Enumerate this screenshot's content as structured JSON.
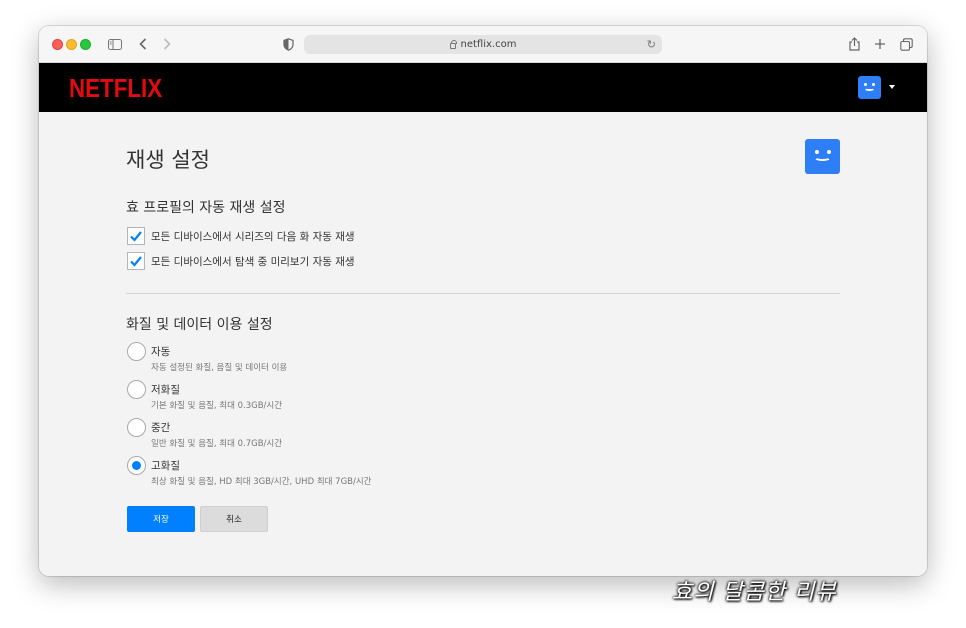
{
  "browser": {
    "url": "netflix.com"
  },
  "header": {
    "logo": "NETFLIX"
  },
  "page": {
    "title": "재생 설정",
    "autoplay_section": {
      "title": "효 프로필의 자동 재생 설정",
      "options": [
        {
          "label": "모든 디바이스에서 시리즈의 다음 화 자동 재생",
          "checked": true
        },
        {
          "label": "모든 디바이스에서 탐색 중 미리보기 자동 재생",
          "checked": true
        }
      ]
    },
    "quality_section": {
      "title": "화질 및 데이터 이용 설정",
      "options": [
        {
          "label": "자동",
          "desc": "자동 설정된 화질, 음질 및 데이터 이용",
          "selected": false
        },
        {
          "label": "저화질",
          "desc": "기본 화질 및 음질, 최대 0.3GB/시간",
          "selected": false
        },
        {
          "label": "중간",
          "desc": "일반 화질 및 음질, 최대 0.7GB/시간",
          "selected": false
        },
        {
          "label": "고화질",
          "desc": "최상 화질 및 음질, HD 최대 3GB/시간, UHD 최대 7GB/시간",
          "selected": true
        }
      ]
    },
    "buttons": {
      "save": "저장",
      "cancel": "취소"
    }
  },
  "watermark": "효의 달콤한 리뷰",
  "colors": {
    "netflix_red": "#e50914",
    "accent_blue": "#0080ff",
    "avatar_blue": "#2e7ef7"
  }
}
